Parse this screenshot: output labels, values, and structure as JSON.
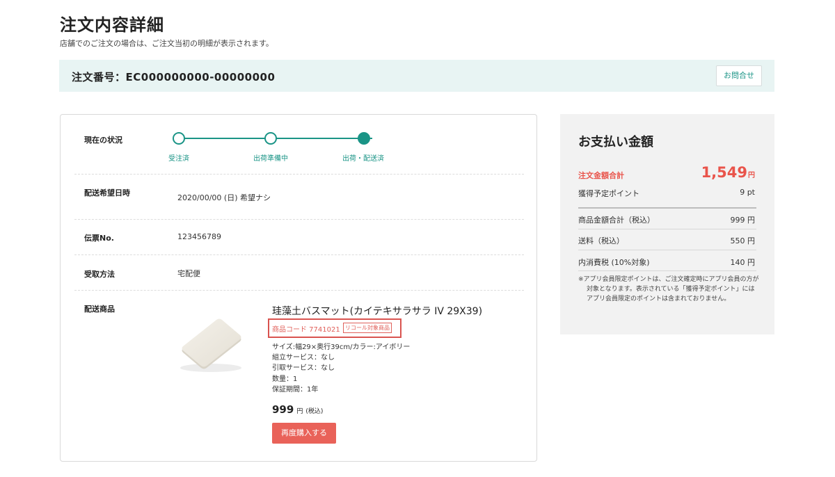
{
  "header": {
    "title": "注文内容詳細",
    "subtitle": "店舗でのご注文の場合は、ご注文当初の明細が表示されます。"
  },
  "order": {
    "number_label": "注文番号：EC000000000-00000000",
    "inquiry_button": "お問合せ"
  },
  "status": {
    "label": "現在の状況",
    "steps": [
      {
        "label": "受注済",
        "done": true
      },
      {
        "label": "出荷準備中",
        "done": true
      },
      {
        "label": "出荷・配送済",
        "current": true
      }
    ]
  },
  "delivery_date": {
    "label": "配送希望日時",
    "value": "2020/00/00 (日) 希望ナシ"
  },
  "slip": {
    "label": "伝票No.",
    "value": "123456789"
  },
  "receive": {
    "label": "受取方法",
    "value": "宅配便"
  },
  "product": {
    "section_label": "配送商品",
    "name": "珪藻土バスマット(カイテキサラサラ IV 29X39)",
    "code": "商品コード 7741021",
    "recall_badge": "リコール対象商品",
    "specs": [
      "サイズ:幅29×奥行39cm/カラー:アイボリー",
      "組立サービス：なし",
      "引取サービス：なし",
      "数量：1",
      "保証期間：1年"
    ],
    "price": "999",
    "price_unit": "円",
    "price_tax": "(税込)",
    "rebuy_button": "再度購入する"
  },
  "payment": {
    "title": "お支払い金額",
    "total_label": "注文金額合計",
    "total_value": "1,549",
    "total_unit": "円",
    "points_label": "獲得予定ポイント",
    "points_value": "9 pt",
    "items": [
      {
        "label": "商品金額合計（税込）",
        "value": "999 円"
      },
      {
        "label": "送料（税込）",
        "value": "550 円"
      },
      {
        "label": "内消費税 (10%対象)",
        "value": "140 円"
      }
    ],
    "note": "※アプリ会員限定ポイントは、ご注文確定時にアプリ会員の方が対象となります。表示されている「獲得予定ポイント」にはアプリ会員限定のポイントは含まれておりません。"
  },
  "colors": {
    "accent": "#1a9486",
    "price_red": "#e9544b",
    "order_bar_bg": "#e8f4f3",
    "payment_bg": "#f2f2f2"
  }
}
